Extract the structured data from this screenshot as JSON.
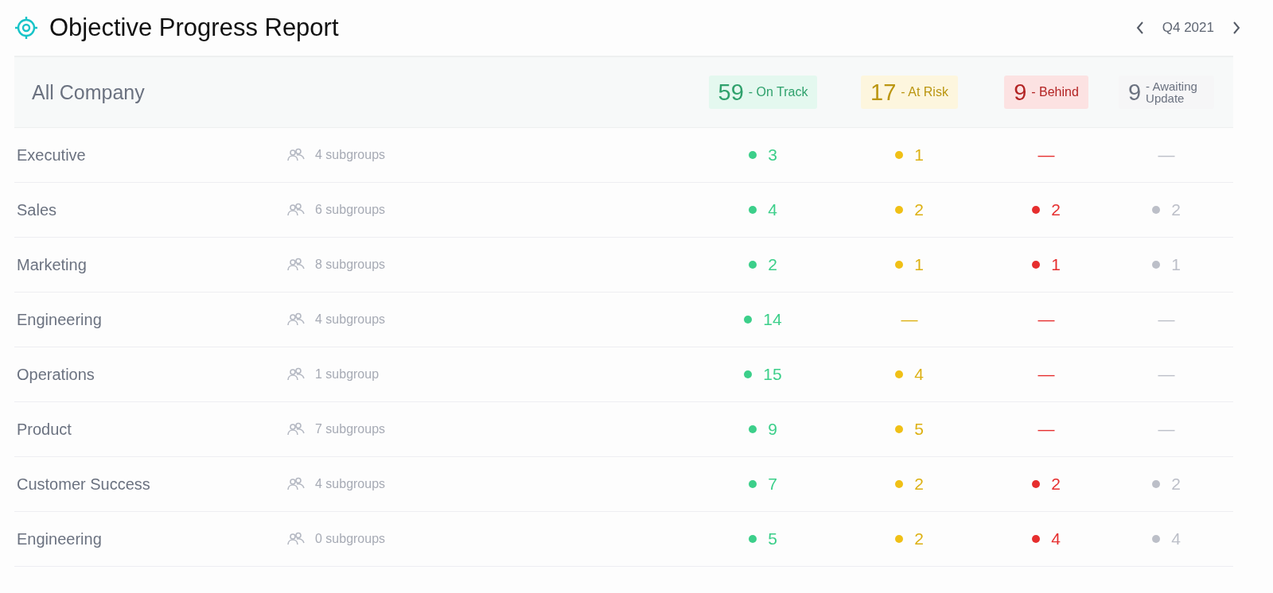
{
  "header": {
    "title": "Objective Progress Report",
    "period": "Q4 2021"
  },
  "summary": {
    "label": "All Company",
    "statuses": [
      {
        "count": "59",
        "label": "- On Track",
        "color": "#3ccf8a"
      },
      {
        "count": "17",
        "label": "- At Risk",
        "color": "#f0c016"
      },
      {
        "count": "9",
        "label": "- Behind",
        "color": "#e62e2e"
      },
      {
        "count": "9",
        "label": "- Awaiting Update",
        "color": "#bcbfc8"
      }
    ]
  },
  "groups": [
    {
      "name": "Executive",
      "subgroups": "4 subgroups",
      "cells": [
        {
          "value": "3",
          "dot": true
        },
        {
          "value": "1",
          "dot": true
        },
        {
          "value": "—",
          "dot": false
        },
        {
          "value": "—",
          "dot": false
        }
      ]
    },
    {
      "name": "Sales",
      "subgroups": "6 subgroups",
      "cells": [
        {
          "value": "4",
          "dot": true
        },
        {
          "value": "2",
          "dot": true
        },
        {
          "value": "2",
          "dot": true
        },
        {
          "value": "2",
          "dot": true
        }
      ]
    },
    {
      "name": "Marketing",
      "subgroups": "8 subgroups",
      "cells": [
        {
          "value": "2",
          "dot": true
        },
        {
          "value": "1",
          "dot": true
        },
        {
          "value": "1",
          "dot": true
        },
        {
          "value": "1",
          "dot": true
        }
      ]
    },
    {
      "name": "Engineering",
      "subgroups": "4 subgroups",
      "cells": [
        {
          "value": "14",
          "dot": true
        },
        {
          "value": "—",
          "dot": false
        },
        {
          "value": "—",
          "dot": false
        },
        {
          "value": "—",
          "dot": false
        }
      ]
    },
    {
      "name": "Operations",
      "subgroups": "1 subgroup",
      "cells": [
        {
          "value": "15",
          "dot": true
        },
        {
          "value": "4",
          "dot": true
        },
        {
          "value": "—",
          "dot": false
        },
        {
          "value": "—",
          "dot": false
        }
      ]
    },
    {
      "name": "Product",
      "subgroups": "7 subgroups",
      "cells": [
        {
          "value": "9",
          "dot": true
        },
        {
          "value": "5",
          "dot": true
        },
        {
          "value": "—",
          "dot": false
        },
        {
          "value": "—",
          "dot": false
        }
      ]
    },
    {
      "name": "Customer Success",
      "subgroups": "4 subgroups",
      "cells": [
        {
          "value": "7",
          "dot": true
        },
        {
          "value": "2",
          "dot": true
        },
        {
          "value": "2",
          "dot": true
        },
        {
          "value": "2",
          "dot": true
        }
      ]
    },
    {
      "name": "Engineering",
      "subgroups": "0 subgroups",
      "cells": [
        {
          "value": "5",
          "dot": true
        },
        {
          "value": "2",
          "dot": true
        },
        {
          "value": "4",
          "dot": true
        },
        {
          "value": "4",
          "dot": true
        }
      ]
    }
  ]
}
